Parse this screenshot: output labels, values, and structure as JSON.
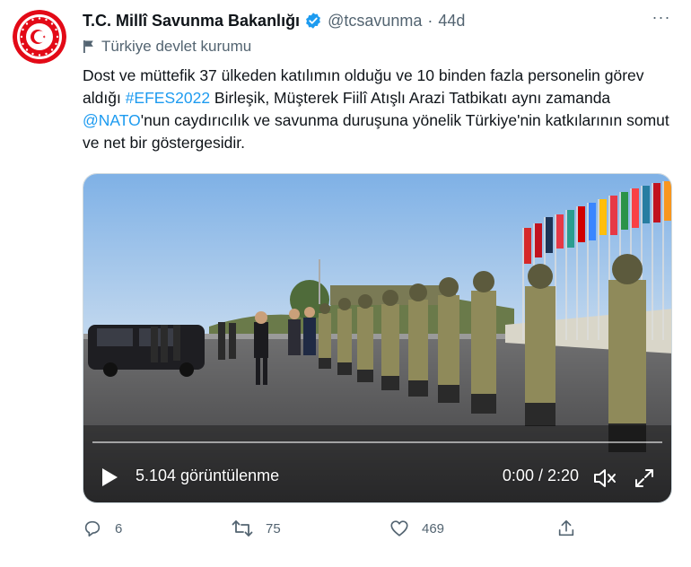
{
  "account": {
    "display_name": "T.C. Millî Savunma Bakanlığı",
    "handle": "@tcsavunma",
    "separator": "·",
    "time": "44d",
    "label": "Türkiye devlet kurumu",
    "more_glyph": "···",
    "avatar_icon": "ministry-emblem-icon",
    "verified_color": "#1d9bf0"
  },
  "tweet": {
    "segment_1": "Dost ve müttefik 37 ülkeden katılımın olduğu ve 10 binden fazla personelin görev aldığı ",
    "hashtag": "#EFES2022",
    "segment_2": " Birleşik, Müşterek Fiilî Atışlı Arazi Tatbikatı aynı zamanda ",
    "mention": "@NATO",
    "segment_3": "'nun caydırıcılık ve savunma duruşuna yönelik Türkiye'nin katkılarının somut ve net bir göstergesidir.",
    "link_color": "#1d9bf0"
  },
  "video": {
    "views": "5.104 görüntülenme",
    "duration": "0:00 / 2:20",
    "progress": 0
  },
  "actions": {
    "replies": "6",
    "retweets": "75",
    "likes": "469"
  }
}
